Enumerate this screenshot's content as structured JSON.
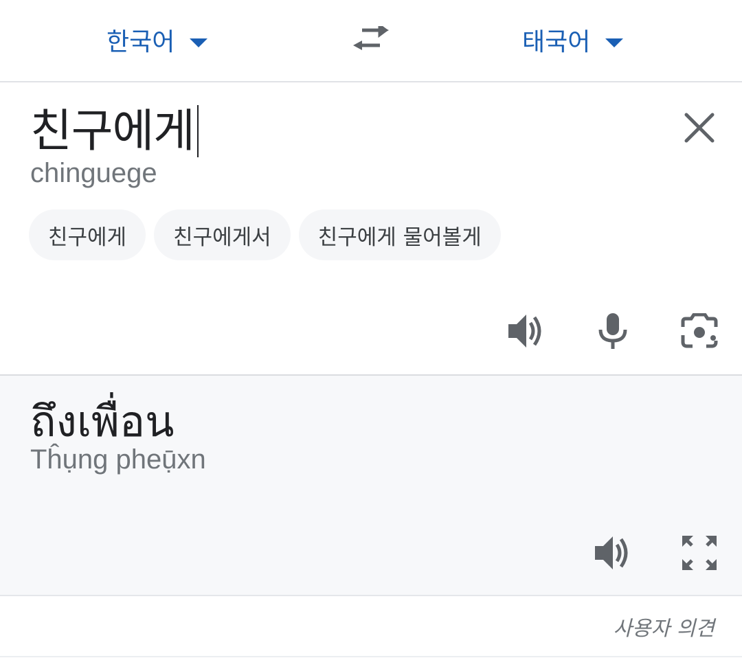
{
  "languages": {
    "source": "한국어",
    "target": "태국어"
  },
  "input": {
    "text": "친구에게",
    "romanization": "chinguege",
    "suggestions": [
      "친구에게",
      "친구에게서",
      "친구에게 물어볼게"
    ]
  },
  "output": {
    "text": "ถึงเพื่อน",
    "transliteration": "Tĥụng pheụ̄xn"
  },
  "footer": {
    "feedback_label": "사용자 의견"
  },
  "icons": {
    "swap": "swap-arrows-icon",
    "clear": "close-icon",
    "speaker": "speaker-icon",
    "mic": "microphone-icon",
    "camera": "camera-icon",
    "fullscreen": "fullscreen-icon"
  },
  "colors": {
    "accent": "#1a5fb4",
    "icon": "#5f6368",
    "output_bg": "#f7f8fa"
  }
}
